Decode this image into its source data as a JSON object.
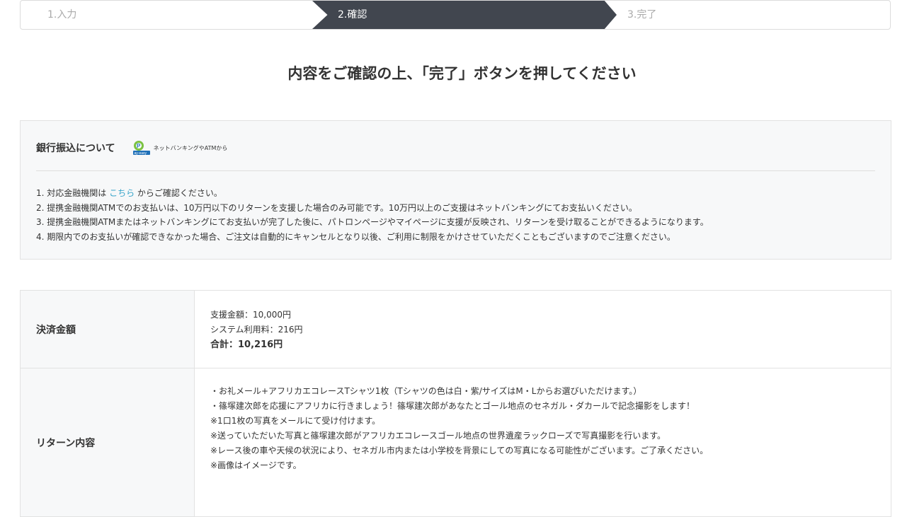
{
  "steps": [
    {
      "label": "1.入力"
    },
    {
      "label": "2.確認"
    },
    {
      "label": "3.完了"
    }
  ],
  "page_title": "内容をご確認の上、「完了」ボタンを押してください",
  "bank": {
    "title": "銀行振込について",
    "payeasy_caption": "ネットバンキングやATMから",
    "note1_prefix": "1. 対応金融機関は ",
    "note1_link": "こちら",
    "note1_suffix": " からご確認ください。",
    "note2": "2. 提携金融機関ATMでのお支払いは、10万円以下のリターンを支援した場合のみ可能です。10万円以上のご支援はネットバンキングにてお支払いください。",
    "note3": "3. 提携金融機関ATMまたはネットバンキングにてお支払いが完了した後に、パトロンページやマイページに支援が反映され、リターンを受け取ることができるようになります。",
    "note4": "4. 期限内でのお支払いが確認できなかった場合、ご注文は自動的にキャンセルとなり以後、ご利用に制限をかけさせていただくこともございますのでご注意ください。"
  },
  "payment": {
    "label": "決済金額",
    "support": "支援金額：10,000円",
    "fee": "システム利用料：216円",
    "total": "合計：10,216円"
  },
  "reward": {
    "label": "リターン内容",
    "lines": [
      "・お礼メール+アフリカエコレースTシャツ1枚（Tシャツの色は白・紫/サイズはM・Lからお選びいただけます。）",
      "・篠塚建次郎を応援にアフリカに行きましょう！篠塚建次郎があなたとゴール地点のセネガル・ダカールで記念撮影をします！",
      "※1口1枚の写真をメールにて受け付けます。",
      "※送っていただいた写真と篠塚建次郎がアフリカエコレースゴール地点の世界遺産ラックローズで写真撮影を行います。",
      "※レース後の車や天候の状況により、セネガル市内または小学校を背景にしての写真になる可能性がございます。ご了承ください。",
      "※画像はイメージです。"
    ]
  },
  "colors": {
    "active_step": "#41464f",
    "link": "#35a3c9",
    "panel_bg": "#f7f8f9"
  }
}
